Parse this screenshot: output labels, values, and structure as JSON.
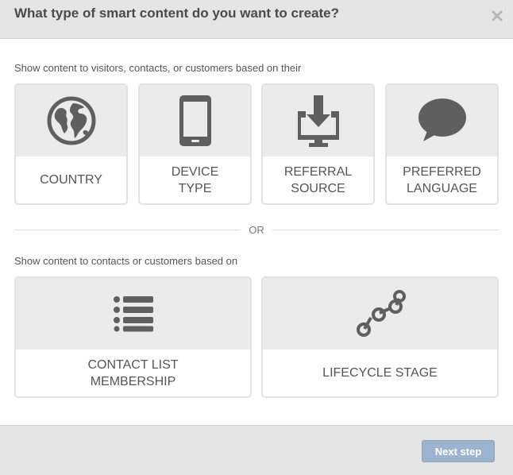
{
  "dialog": {
    "title": "What type of smart content do you want to create?",
    "close_icon": "close-icon"
  },
  "section1": {
    "label": "Show content to visitors, contacts, or customers based on their",
    "cards": [
      {
        "icon": "globe-icon",
        "line1": "COUNTRY",
        "line2": ""
      },
      {
        "icon": "mobile-device-icon",
        "line1": "DEVICE",
        "line2": "TYPE"
      },
      {
        "icon": "download-inbox-icon",
        "line1": "REFERRAL",
        "line2": "SOURCE"
      },
      {
        "icon": "speech-bubble-icon",
        "line1": "PREFERRED",
        "line2": "LANGUAGE"
      }
    ]
  },
  "divider": {
    "text": "OR"
  },
  "section2": {
    "label": "Show content to contacts or customers based on",
    "cards": [
      {
        "icon": "list-icon",
        "line1": "CONTACT LIST",
        "line2": "MEMBERSHIP"
      },
      {
        "icon": "lifecycle-stages-icon",
        "line1": "LIFECYCLE STAGE",
        "line2": ""
      }
    ]
  },
  "footer": {
    "next_label": "Next step"
  },
  "colors": {
    "header_bg": "#e5e5e5",
    "card_top_bg": "#ebebeb",
    "icon": "#5f5f5f",
    "button_disabled": "#9db4d0"
  }
}
